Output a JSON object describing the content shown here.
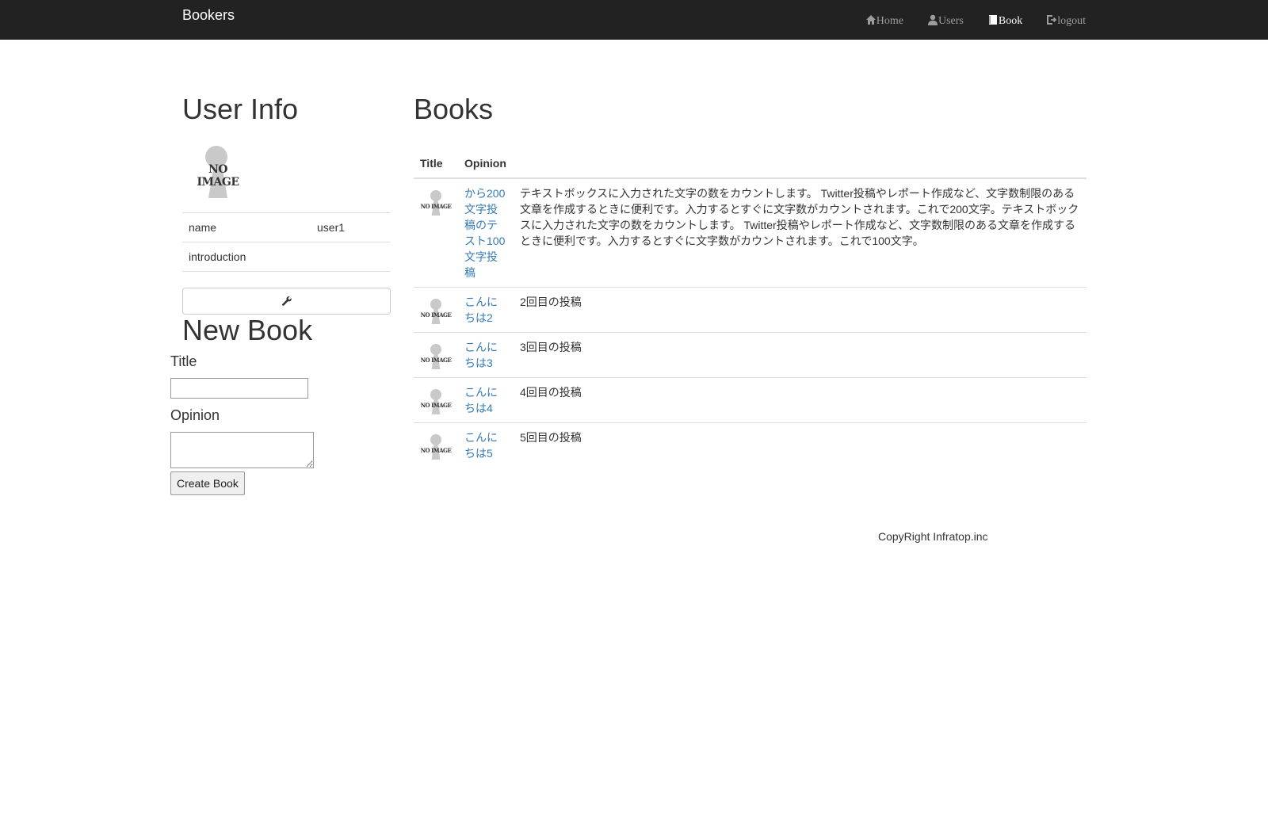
{
  "colors": {
    "navbar_bg": "#222222",
    "nav_inactive": "#9d9d9d",
    "nav_active": "#ffffff",
    "link": "#337ab7",
    "border": "#dddddd"
  },
  "navbar": {
    "brand": "Bookers",
    "items": [
      {
        "label": "Home",
        "icon": "home-icon",
        "active": false
      },
      {
        "label": "Users",
        "icon": "user-icon",
        "active": false
      },
      {
        "label": "Book",
        "icon": "book-icon",
        "active": true
      },
      {
        "label": "logout",
        "icon": "logout-icon",
        "active": false
      }
    ]
  },
  "user_info": {
    "heading": "User Info",
    "image_text": "NO IMAGE",
    "rows": [
      {
        "label": "name",
        "value": "user1"
      },
      {
        "label": "introduction",
        "value": ""
      }
    ],
    "edit_icon": "wrench-icon"
  },
  "new_book": {
    "heading": "New Book",
    "title_label": "Title",
    "title_value": "",
    "opinion_label": "Opinion",
    "opinion_value": "",
    "submit_label": "Create Book"
  },
  "books": {
    "heading": "Books",
    "columns": [
      "Title",
      "Opinion"
    ],
    "thumb_text": "NO IMAGE",
    "rows": [
      {
        "title": "から200文字投稿のテスト100文字投稿",
        "opinion": "テキストボックスに入力された文字の数をカウントします。 Twitter投稿やレポート作成など、文字数制限のある文章を作成するときに便利です。入力するとすぐに文字数がカウントされます。これで200文字。テキストボックスに入力された文字の数をカウントします。 Twitter投稿やレポート作成など、文字数制限のある文章を作成するときに便利です。入力するとすぐに文字数がカウントされます。これで100文字。"
      },
      {
        "title": "こんにちは2",
        "opinion": "2回目の投稿"
      },
      {
        "title": "こんにちは3",
        "opinion": "3回目の投稿"
      },
      {
        "title": "こんにちは4",
        "opinion": "4回目の投稿"
      },
      {
        "title": "こんにちは5",
        "opinion": "5回目の投稿"
      }
    ]
  },
  "footer": {
    "text": "CopyRight Infratop.inc"
  }
}
